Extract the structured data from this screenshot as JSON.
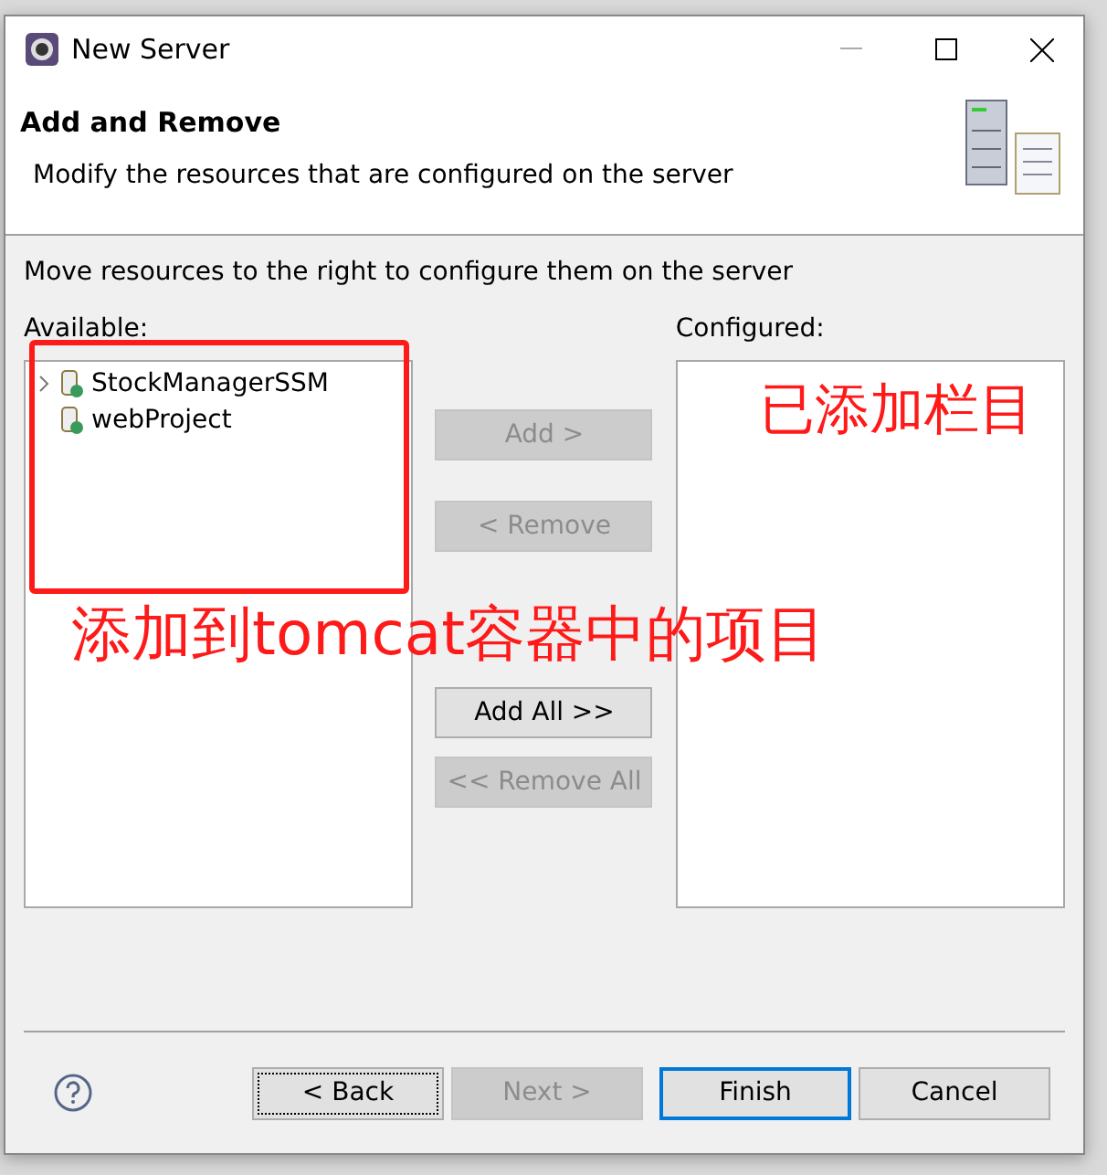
{
  "window": {
    "title": "New Server"
  },
  "header": {
    "title": "Add and Remove",
    "description": "Modify the resources that are configured on the server"
  },
  "instruction": "Move resources to the right to configure them on the server",
  "available": {
    "label": "Available:",
    "items": [
      {
        "label": "StockManagerSSM",
        "expandable": true
      },
      {
        "label": "webProject",
        "expandable": false
      }
    ]
  },
  "configured": {
    "label": "Configured:"
  },
  "move_buttons": [
    {
      "label": "Add >",
      "disabled": true
    },
    {
      "label": "< Remove",
      "disabled": true
    },
    {
      "label": "Add All >>",
      "disabled": false
    },
    {
      "label": "<< Remove All",
      "disabled": true
    }
  ],
  "annotations": [
    {
      "kind": "box"
    },
    {
      "kind": "text",
      "text": "已添加栏目"
    },
    {
      "kind": "text",
      "text": "添加到tomcat容器中的项目"
    }
  ],
  "footer_buttons": [
    {
      "label": "< Back",
      "disabled": false,
      "focused": true,
      "default": false
    },
    {
      "label": "Next >",
      "disabled": true,
      "focused": false,
      "default": false
    },
    {
      "label": "Finish",
      "disabled": false,
      "focused": false,
      "default": true
    },
    {
      "label": "Cancel",
      "disabled": false,
      "focused": false,
      "default": false
    }
  ]
}
